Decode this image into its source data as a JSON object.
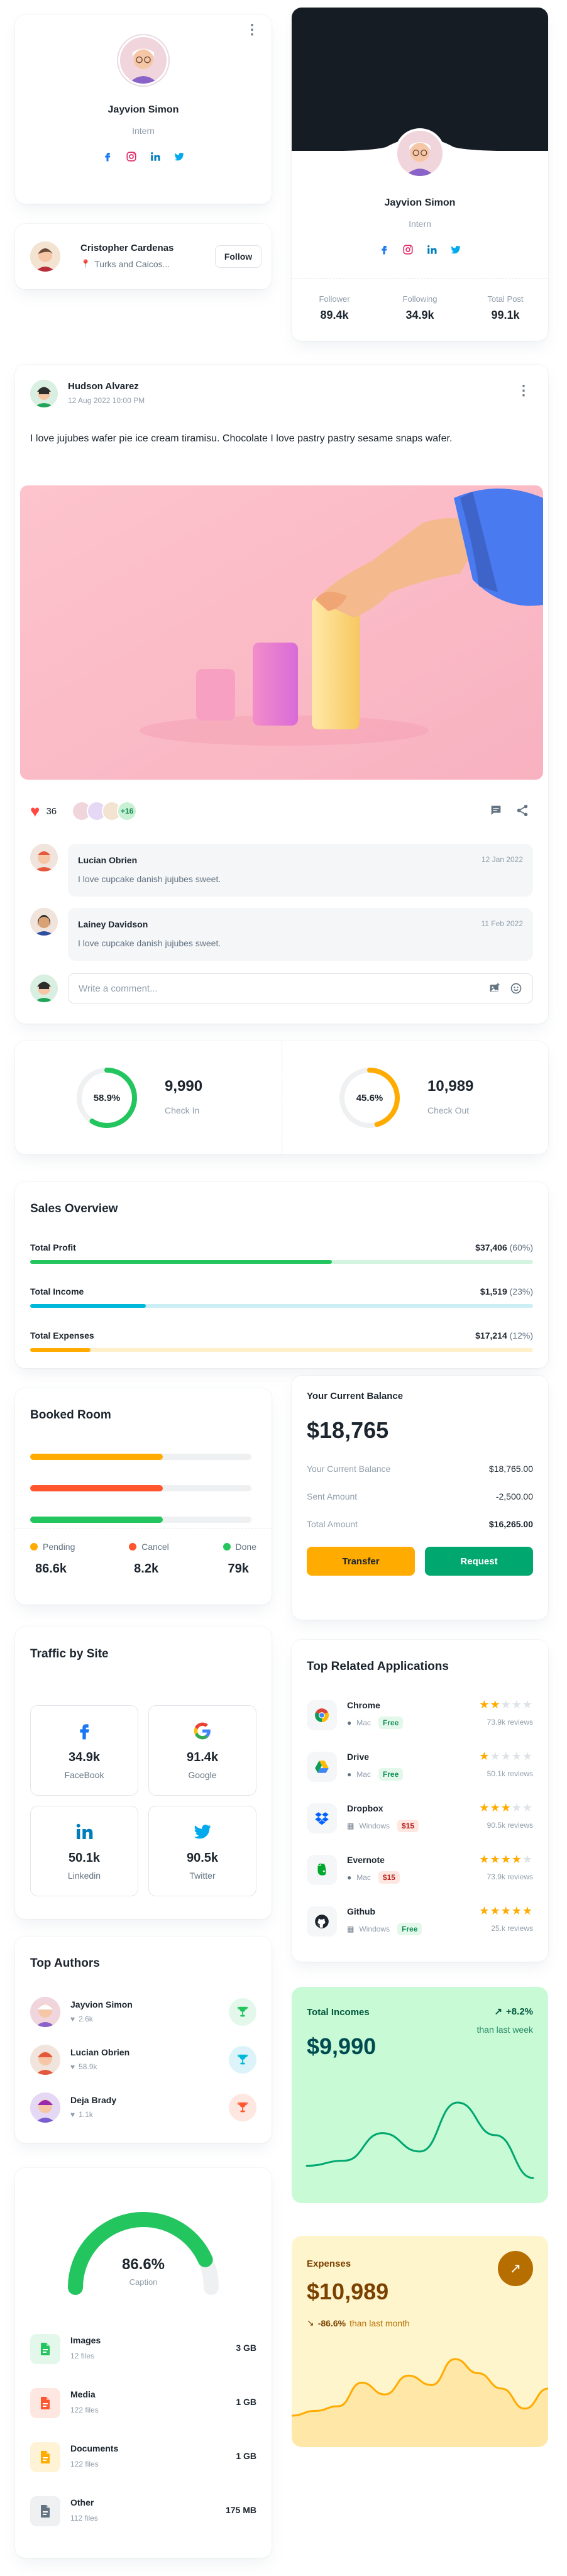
{
  "profile_card": {
    "name": "Jayvion Simon",
    "role": "Intern"
  },
  "follow_card": {
    "name": "Cristopher Cardenas",
    "location": "Turks and Caicos...",
    "follow_label": "Follow"
  },
  "cover_profile": {
    "name": "Jayvion Simon",
    "role": "Intern",
    "stats": [
      {
        "label": "Follower",
        "value": "89.4k"
      },
      {
        "label": "Following",
        "value": "34.9k"
      },
      {
        "label": "Total Post",
        "value": "99.1k"
      }
    ]
  },
  "post": {
    "author": "Hudson Alvarez",
    "date": "12 Aug 2022 10:00 PM",
    "text": "I love jujubes wafer pie ice cream tiramisu. Chocolate I love pastry pastry sesame snaps wafer.",
    "likes": "36",
    "extra_avatars": "+16",
    "comments": [
      {
        "name": "Lucian Obrien",
        "date": "12 Jan 2022",
        "text": "I love cupcake danish jujubes sweet."
      },
      {
        "name": "Lainey Davidson",
        "date": "11 Feb 2022",
        "text": "I love cupcake danish jujubes sweet."
      }
    ],
    "comment_placeholder": "Write a comment..."
  },
  "check": {
    "in": {
      "percent_label": "58.9%",
      "percent": 58.9,
      "value": "9,990",
      "label": "Check In",
      "color": "#22c55e"
    },
    "out": {
      "percent_label": "45.6%",
      "percent": 45.6,
      "value": "10,989",
      "label": "Check Out",
      "color": "#ffab00"
    }
  },
  "sales": {
    "title": "Sales Overview",
    "rows": [
      {
        "label": "Total Profit",
        "amount": "$37,406",
        "percent_text": "(60%)",
        "percent": 60,
        "color": "#22c55e",
        "track": "#d3f5df"
      },
      {
        "label": "Total Income",
        "amount": "$1,519",
        "percent_text": "(23%)",
        "percent": 23,
        "color": "#00b8d9",
        "track": "#cceff5"
      },
      {
        "label": "Total Expenses",
        "amount": "$17,214",
        "percent_text": "(12%)",
        "percent": 12,
        "color": "#ffab00",
        "track": "#fff0cc"
      }
    ]
  },
  "booked": {
    "title": "Booked Room",
    "bars": [
      {
        "fill": 60,
        "color": "#ffab00"
      },
      {
        "fill": 60,
        "color": "#ff5630"
      },
      {
        "fill": 60,
        "color": "#22c55e"
      }
    ],
    "legend": [
      {
        "label": "Pending",
        "value": "86.6k",
        "color": "#ffab00"
      },
      {
        "label": "Cancel",
        "value": "8.2k",
        "color": "#ff5630"
      },
      {
        "label": "Done",
        "value": "79k",
        "color": "#22c55e"
      }
    ]
  },
  "balance": {
    "title": "Your Current Balance",
    "amount": "$18,765",
    "rows": [
      {
        "label": "Your Current Balance",
        "value": "$18,765.00"
      },
      {
        "label": "Sent Amount",
        "value": "-2,500.00"
      },
      {
        "label": "Total Amount",
        "value": "$16,265.00"
      }
    ],
    "transfer_label": "Transfer",
    "request_label": "Request"
  },
  "traffic": {
    "title": "Traffic by Site",
    "sites": [
      {
        "value": "34.9k",
        "name": "FaceBook"
      },
      {
        "value": "91.4k",
        "name": "Google"
      },
      {
        "value": "50.1k",
        "name": "Linkedin"
      },
      {
        "value": "90.5k",
        "name": "Twitter"
      }
    ]
  },
  "apps": {
    "title": "Top Related Applications",
    "items": [
      {
        "name": "Chrome",
        "os": "Mac",
        "price": "Free",
        "stars": 2,
        "reviews": "73.9k reviews",
        "icon": "chrome-icon"
      },
      {
        "name": "Drive",
        "os": "Mac",
        "price": "Free",
        "stars": 1,
        "reviews": "50.1k reviews",
        "icon": "drive-icon"
      },
      {
        "name": "Dropbox",
        "os": "Windows",
        "price": "$15",
        "stars": 3,
        "reviews": "90.5k reviews",
        "icon": "dropbox-icon"
      },
      {
        "name": "Evernote",
        "os": "Mac",
        "price": "$15",
        "stars": 4,
        "reviews": "73.9k reviews",
        "icon": "evernote-icon"
      },
      {
        "name": "Github",
        "os": "Windows",
        "price": "Free",
        "stars": 5,
        "reviews": "25.k reviews",
        "icon": "github-icon"
      }
    ]
  },
  "authors": {
    "title": "Top Authors",
    "items": [
      {
        "name": "Jayvion Simon",
        "likes": "2.6k",
        "trophy_color": "#22c55e",
        "trophy_bg": "#e3f8ea"
      },
      {
        "name": "Lucian Obrien",
        "likes": "58.9k",
        "trophy_color": "#00b8d9",
        "trophy_bg": "#dcf4f9"
      },
      {
        "name": "Deja Brady",
        "likes": "1.1k",
        "trophy_color": "#ff5630",
        "trophy_bg": "#ffe7e1"
      }
    ]
  },
  "incomes": {
    "title": "Total Incomes",
    "change": "+8.2%",
    "change_note": "than last week",
    "amount": "$9,990",
    "values": [
      30,
      35,
      62,
      44,
      92,
      60,
      18
    ]
  },
  "expenses": {
    "title": "Expenses",
    "change": "-86.6%",
    "change_note": "than last month",
    "amount": "$10,989",
    "values": [
      22,
      26,
      30,
      50,
      40,
      56,
      48,
      70,
      58,
      45,
      28,
      45
    ]
  },
  "storage": {
    "percent_label": "86.6%",
    "percent": 86.6,
    "caption": "Caption",
    "items": [
      {
        "name": "Images",
        "files": "12 files",
        "size": "3 GB",
        "icon": "image-file-icon",
        "color": "#22c55e",
        "bg": "#e3f8ea"
      },
      {
        "name": "Media",
        "files": "122 files",
        "size": "1 GB",
        "icon": "media-file-icon",
        "color": "#ff5630",
        "bg": "#ffe7e1"
      },
      {
        "name": "Documents",
        "files": "122 files",
        "size": "1 GB",
        "icon": "document-file-icon",
        "color": "#ffab00",
        "bg": "#fff3d6"
      },
      {
        "name": "Other",
        "files": "112 files",
        "size": "175 MB",
        "icon": "other-file-icon",
        "color": "#637381",
        "bg": "#eef0f2"
      }
    ]
  }
}
